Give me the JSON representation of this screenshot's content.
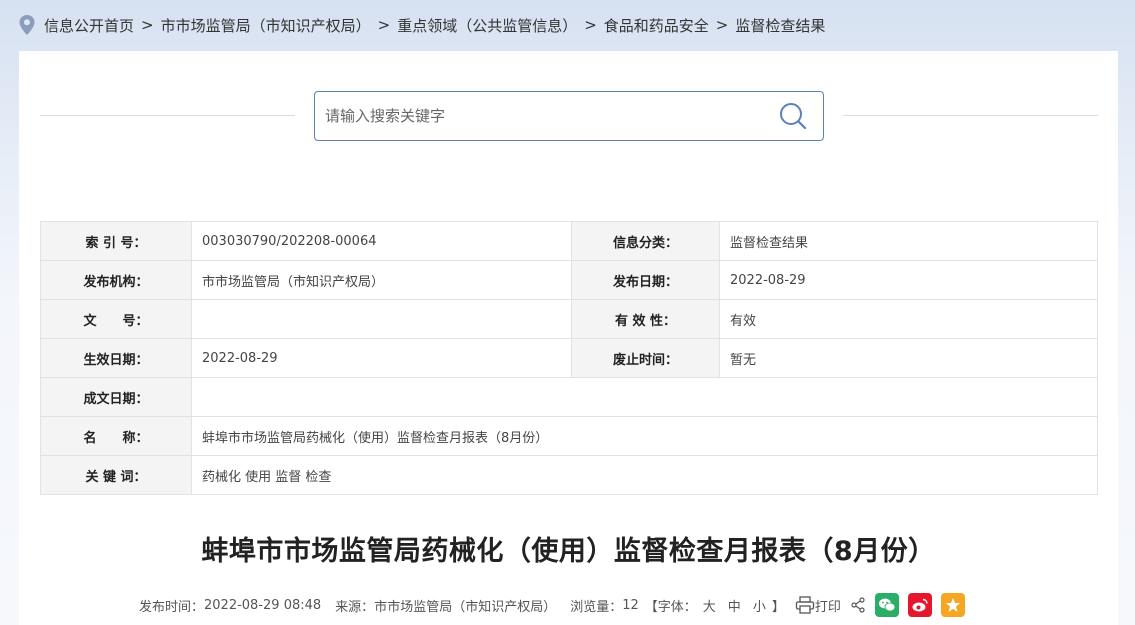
{
  "breadcrumb": {
    "items": [
      "信息公开首页",
      "市市场监管局（市知识产权局）",
      "重点领域（公共监管信息）",
      "食品和药品安全",
      "监督检查结果"
    ],
    "separator": ">"
  },
  "search": {
    "placeholder": "请输入搜索关键字",
    "value": ""
  },
  "meta": {
    "index_label": "索 引 号：",
    "index_value": "003030790/202208-00064",
    "category_label": "信息分类：",
    "category_value": "监督检查结果",
    "publisher_label": "发布机构：",
    "publisher_value": "市市场监管局（市知识产权局）",
    "pubdate_label": "发布日期：",
    "pubdate_value": "2022-08-29",
    "docno_label": "文　　号：",
    "docno_value": "",
    "validity_label": "有 效 性：",
    "validity_value": "有效",
    "effective_label": "生效日期：",
    "effective_value": "2022-08-29",
    "abolish_label": "废止时间：",
    "abolish_value": "暂无",
    "written_label": "成文日期：",
    "written_value": "",
    "name_label": "名　　称：",
    "name_value": "蚌埠市市场监管局药械化（使用）监督检查月报表（8月份）",
    "keywords_label": "关 键 词：",
    "keywords_value": "药械化 使用 监督 检查"
  },
  "article": {
    "title": "蚌埠市市场监管局药械化（使用）监督检查月报表（8月份）",
    "publish_time_label": "发布时间：",
    "publish_time": "2022-08-29 08:48",
    "source_label": "来源：",
    "source": "市市场监管局（市知识产权局）",
    "views_label": "浏览量：",
    "views": "12",
    "font_label": "【字体：",
    "font_large": "大",
    "font_medium": "中",
    "font_small": "小",
    "font_close": "】",
    "print_label": "打印"
  },
  "colors": {
    "wechat": "#2aae67",
    "weibo": "#e6162d",
    "favorite": "#f5a623",
    "accent": "#5a82b8"
  },
  "icons": [
    "location-icon",
    "search-icon",
    "print-icon",
    "share-icon",
    "wechat-icon",
    "weibo-icon",
    "favorite-icon"
  ]
}
